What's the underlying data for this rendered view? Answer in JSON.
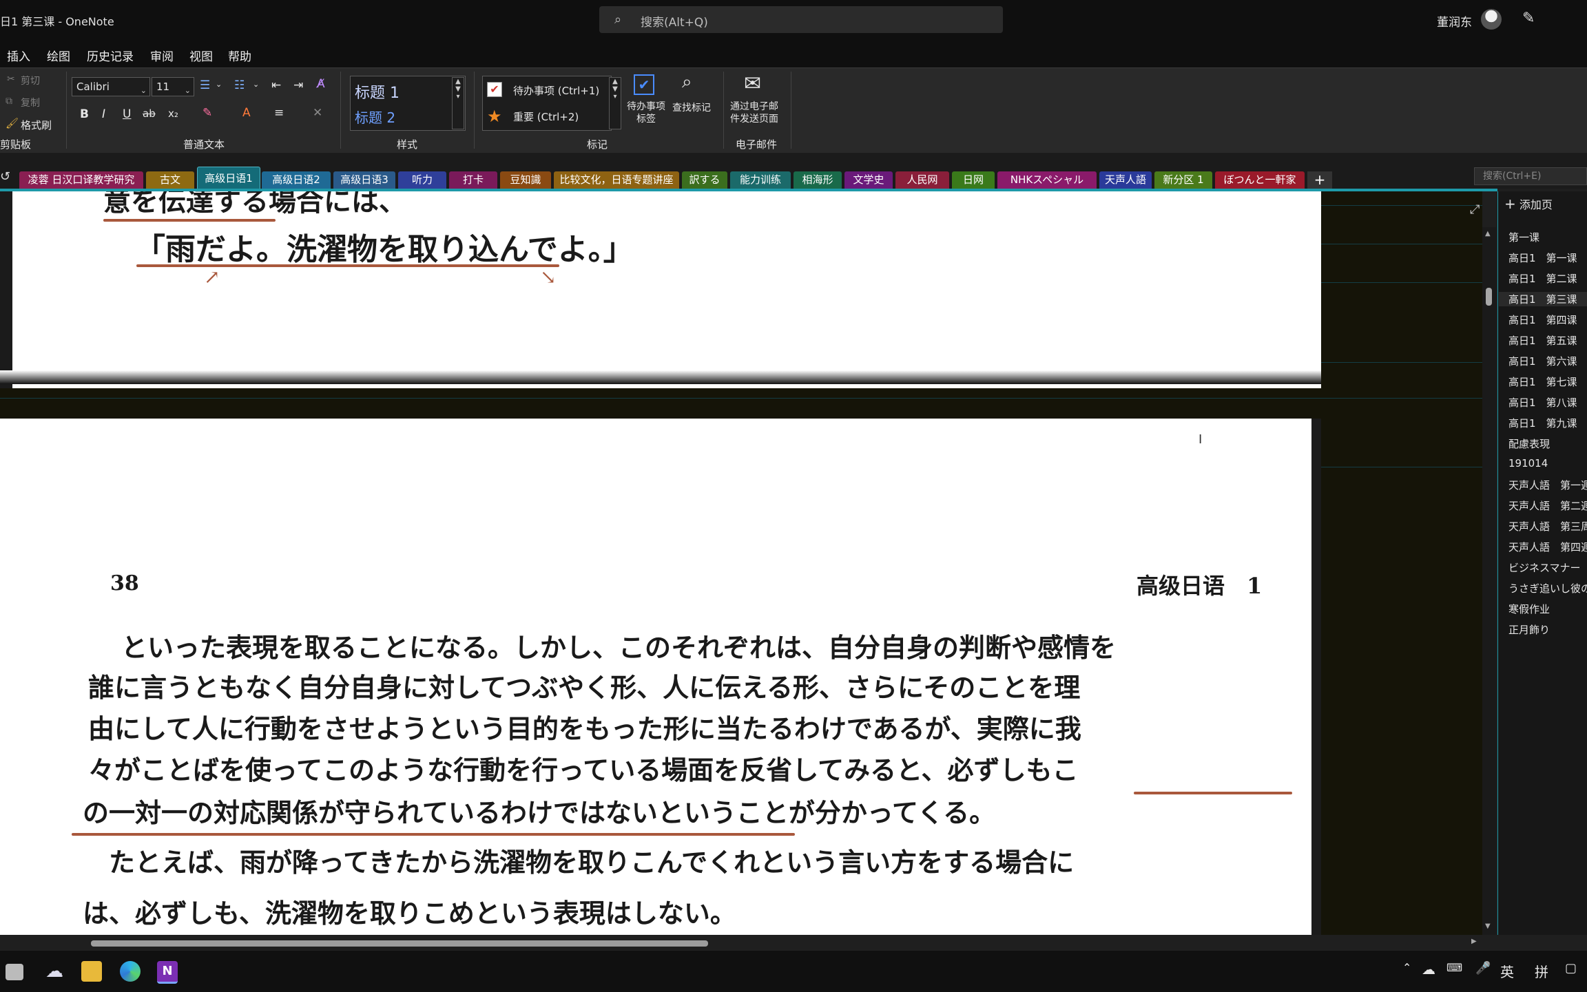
{
  "window": {
    "title": "日1 第三课 - OneNote"
  },
  "search": {
    "placeholder": "搜索(Alt+Q)"
  },
  "user": {
    "name": "董润东"
  },
  "menu": [
    "插入",
    "绘图",
    "历史记录",
    "审阅",
    "视图",
    "帮助"
  ],
  "ribbon": {
    "clipboard": {
      "cut": "剪切",
      "copy": "复制",
      "format_painter": "格式刷",
      "label": "剪贴板"
    },
    "basic_text": {
      "font": "Calibri",
      "size": "11",
      "label": "普通文本",
      "bold": "B",
      "italic": "I",
      "underline": "U",
      "strike": "ab",
      "subscript": "x₂"
    },
    "styles": {
      "h1": "标题 1",
      "h2": "标题 2",
      "label": "样式"
    },
    "tags": {
      "todo": "待办事项 (Ctrl+1)",
      "important": "重要 (Ctrl+2)",
      "todo_tag_btn": "待办事项\n标签",
      "find_tags": "查找标记",
      "label": "标记"
    },
    "email": {
      "send": "通过电子邮\n件发送页面",
      "label": "电子邮件"
    }
  },
  "sections": [
    {
      "label": "凌蓉 日汉口译教学研究",
      "color": "#8a1f52"
    },
    {
      "label": "古文",
      "color": "#8e6a12"
    },
    {
      "label": "高级日语1",
      "color": "#146b78",
      "active": true
    },
    {
      "label": "高级日语2",
      "color": "#1f6a95"
    },
    {
      "label": "高级日语3",
      "color": "#2a5a8a"
    },
    {
      "label": "听力",
      "color": "#2f3f9a"
    },
    {
      "label": "打卡",
      "color": "#7a1a5a"
    },
    {
      "label": "豆知識",
      "color": "#8a4a12"
    },
    {
      "label": "比较文化，日语专题讲座",
      "color": "#8e6212"
    },
    {
      "label": "訳する",
      "color": "#3b6e1e"
    },
    {
      "label": "能力训练",
      "color": "#1b6a6a"
    },
    {
      "label": "相海形",
      "color": "#196a4a"
    },
    {
      "label": "文学史",
      "color": "#6a1a7a"
    },
    {
      "label": "人民网",
      "color": "#8a1f3a"
    },
    {
      "label": "日网",
      "color": "#3a7a1a"
    },
    {
      "label": "NHKスペシャル",
      "color": "#8a1a6a"
    },
    {
      "label": "天声人語",
      "color": "#2a3a9a"
    },
    {
      "label": "新分区 1",
      "color": "#4a7a1a"
    },
    {
      "label": "ぼつんと一軒家",
      "color": "#9a1a2a"
    }
  ],
  "notebook_search": {
    "placeholder": "搜索(Ctrl+E)"
  },
  "pages": {
    "add_label": "添加页",
    "items": [
      {
        "label": "第一课"
      },
      {
        "label": "高日1　第一课"
      },
      {
        "label": "高日1　第二课"
      },
      {
        "label": "高日1　第三课",
        "selected": true
      },
      {
        "label": "高日1　第四课"
      },
      {
        "label": "高日1　第五课"
      },
      {
        "label": "高日1　第六课"
      },
      {
        "label": "高日1　第七课"
      },
      {
        "label": "高日1　第八课"
      },
      {
        "label": "高日1　第九课"
      },
      {
        "label": "配慮表現"
      },
      {
        "label": "191014"
      },
      {
        "label": "天声人語　第一週"
      },
      {
        "label": "天声人語　第二週"
      },
      {
        "label": "天声人語　第三周"
      },
      {
        "label": "天声人語　第四週"
      },
      {
        "label": "ビジネスマナー"
      },
      {
        "label": "うさぎ追いし彼の"
      },
      {
        "label": "寒假作业"
      },
      {
        "label": "正月飾り"
      }
    ]
  },
  "scan_top": {
    "line1": "意を伝達する場合には、",
    "line2": "「雨だよ。洗濯物を取り込んでよ。」"
  },
  "scan_page": {
    "page_number": "38",
    "header": "高级日语　1",
    "lines": [
      "といった表現を取ることになる。しかし、このそれぞれは、自分自身の判断や感情を",
      "誰に言うともなく自分自身に対してつぶやく形、人に伝える形、さらにそのことを理",
      "由にして人に行動をさせようという目的をもった形に当たるわけであるが、実際に我",
      "々がことばを使ってこのような行動を行っている場面を反省してみると、必ずしもこ",
      "の一対一の対応関係が守られているわけではないということが分かってくる。",
      "　たとえば、雨が降ってきたから洗濯物を取りこんでくれという言い方をする場合に",
      "は、必ずしも、洗濯物を取りこめという表現はしない。"
    ]
  },
  "taskbar": {
    "ime_lang": "英",
    "ime_mode": "拼"
  },
  "colors": {
    "accent": "#1e9aa9",
    "ink_underline": "#a9583c"
  }
}
